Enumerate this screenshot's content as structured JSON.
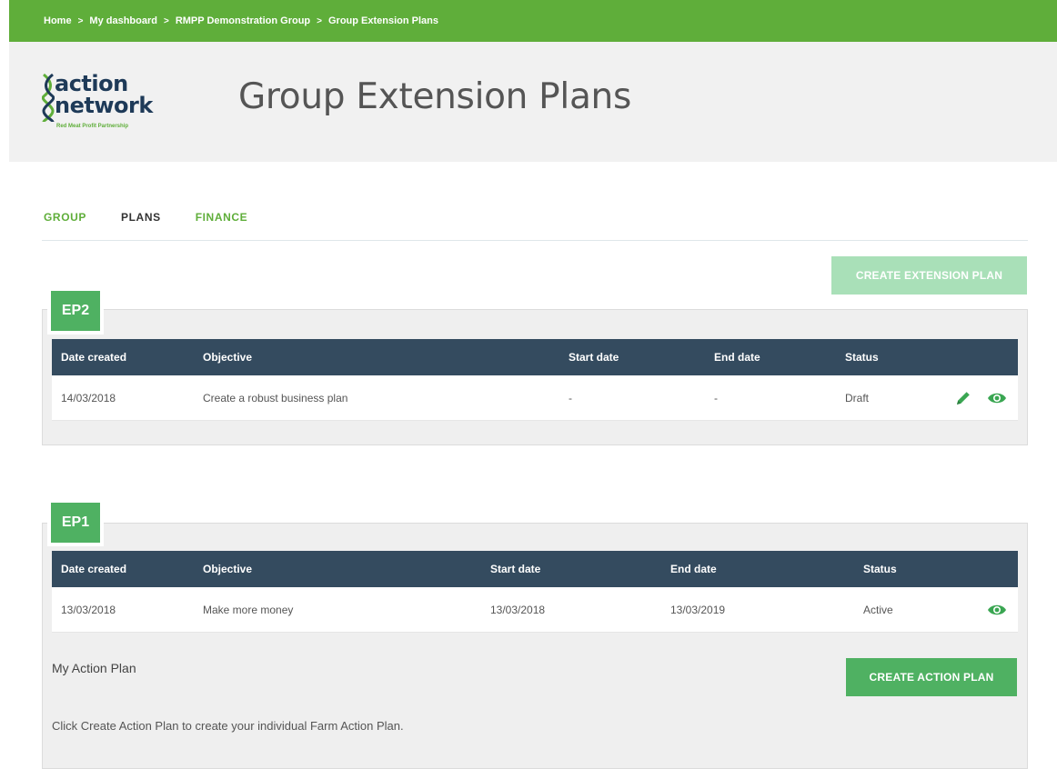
{
  "breadcrumb": [
    "Home",
    "My dashboard",
    "RMPP Demonstration Group",
    "Group Extension Plans"
  ],
  "logo": {
    "line1": "action",
    "line2": "network",
    "tagline": "Red Meat Profit Partnership"
  },
  "page": {
    "title": "Group Extension Plans"
  },
  "tabs": [
    {
      "label": "GROUP",
      "active": false
    },
    {
      "label": "PLANS",
      "active": true
    },
    {
      "label": "FINANCE",
      "active": false
    }
  ],
  "create_extension_plan_label": "CREATE EXTENSION PLAN",
  "plans": [
    {
      "badge": "EP2",
      "columns": [
        "Date created",
        "Objective",
        "Start date",
        "End date",
        "Status"
      ],
      "row": {
        "date_created": "14/03/2018",
        "objective": "Create a robust business plan",
        "start_date": "-",
        "end_date": "-",
        "status": "Draft"
      },
      "actions": [
        "edit-pencil-icon",
        "view-eye-icon"
      ]
    },
    {
      "badge": "EP1",
      "columns": [
        "Date created",
        "Objective",
        "Start date",
        "End date",
        "Status"
      ],
      "row": {
        "date_created": "13/03/2018",
        "objective": "Make more money",
        "start_date": "13/03/2018",
        "end_date": "13/03/2019",
        "status": "Active"
      },
      "actions": [
        "view-eye-icon"
      ],
      "action_plan": {
        "heading": "My Action Plan",
        "description": "Click Create Action Plan to create your individual Farm Action Plan.",
        "button_label": "CREATE ACTION PLAN"
      }
    }
  ],
  "colors": {
    "brand_green": "#5fae3a",
    "button_green": "#4fb162",
    "button_green_disabled": "#a9e0b8",
    "table_header": "#344b5f",
    "logo_navy": "#1e3a58"
  }
}
